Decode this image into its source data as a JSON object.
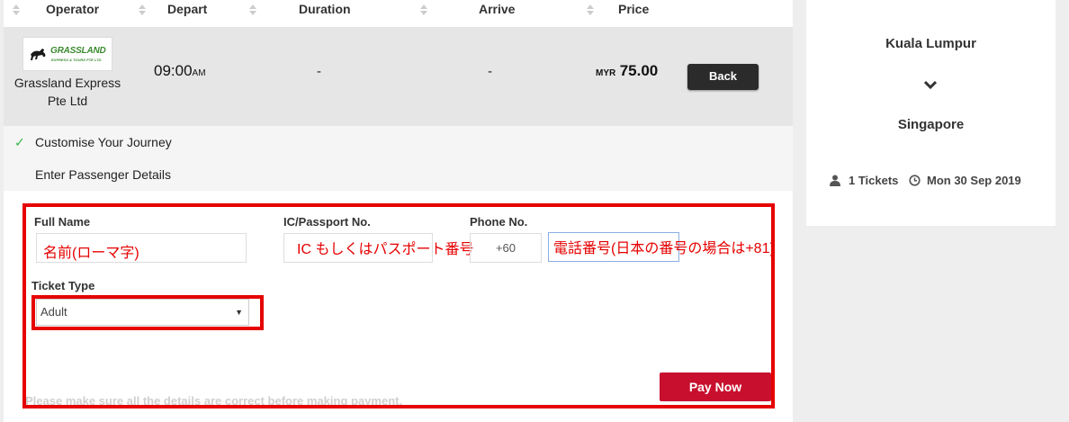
{
  "table_header": {
    "operator": "Operator",
    "depart": "Depart",
    "duration": "Duration",
    "arrive": "Arrive",
    "price": "Price"
  },
  "trip": {
    "logo_text": "GRASSLAND",
    "logo_subtext": "EXPRESS & TOURS PTE LTD",
    "operator_line1": "Grassland Express",
    "operator_line2": "Pte Ltd",
    "depart_time": "09:00",
    "depart_ampm": "AM",
    "duration": "-",
    "arrive": "-",
    "currency": "MYR",
    "price": "75.00",
    "back_label": "Back"
  },
  "steps": [
    {
      "label": "Customise Your Journey",
      "done": true,
      "check": "✓"
    },
    {
      "label": "Enter Passenger Details",
      "done": false
    }
  ],
  "form": {
    "full_name_label": "Full Name",
    "ic_label": "IC/Passport No.",
    "phone_label": "Phone No.",
    "phone_code": "+60",
    "ticket_type_label": "Ticket Type",
    "ticket_type_value": "Adult",
    "note": "Please make sure all the details are correct before making payment.",
    "pay_label": "Pay Now"
  },
  "annotations": {
    "name": "名前(ローマ字)",
    "ic": "IC もしくはパスポート番号",
    "phone": "電話番号(日本の番号の場合は+81)"
  },
  "summary": {
    "from": "Kuala Lumpur",
    "to": "Singapore",
    "tickets": "1 Tickets",
    "date": "Mon 30 Sep 2019"
  },
  "colors": {
    "accent_red": "#c8102e",
    "annotation_red": "#e60000",
    "check_green": "#39b54a"
  }
}
